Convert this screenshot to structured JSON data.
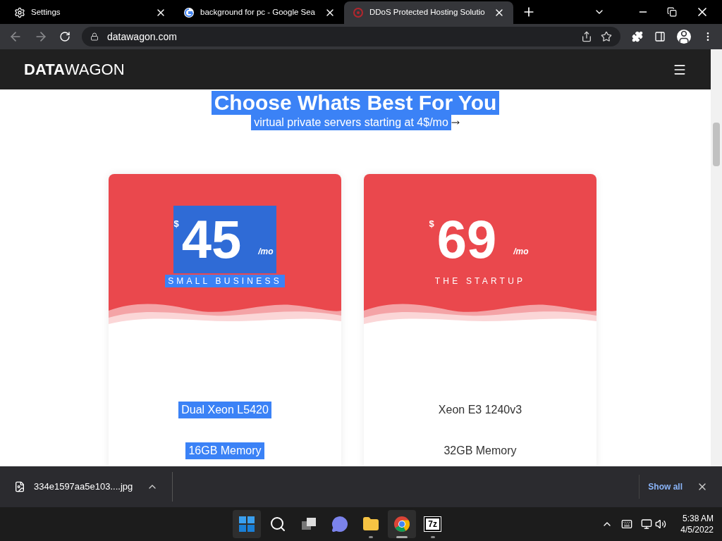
{
  "browser": {
    "tabs": [
      {
        "kind": "settings",
        "title": "Settings",
        "selected": false
      },
      {
        "kind": "google",
        "title": "background for pc - Google Sea",
        "selected": false
      },
      {
        "kind": "site",
        "title": "DDoS Protected Hosting Solutio",
        "selected": true
      }
    ],
    "url": "datawagon.com"
  },
  "site": {
    "logo_bold": "DATA",
    "logo_light": "WAGON",
    "heading": {
      "text": "Choose Whats Best For You",
      "highlighted": true
    },
    "subheading": {
      "text": "virtual private servers starting at 4$/mo",
      "highlighted": true
    },
    "cards": [
      {
        "currency": "$",
        "price": "45",
        "period": "/mo",
        "tier": "SMALL BUSINESS",
        "highlighted": true,
        "features": [
          {
            "text": "Dual Xeon L5420",
            "highlighted": true
          },
          {
            "text": "16GB Memory",
            "highlighted": true
          }
        ]
      },
      {
        "currency": "$",
        "price": "69",
        "period": "/mo",
        "tier": "THE STARTUP",
        "highlighted": false,
        "features": [
          {
            "text": "Xeon E3 1240v3",
            "highlighted": false
          },
          {
            "text": "32GB Memory",
            "highlighted": false
          }
        ]
      }
    ]
  },
  "downloads": {
    "file": "334e1597aa5e103....jpg",
    "show_all": "Show all"
  },
  "taskbar": {
    "apps": [
      {
        "kind": "start",
        "running": false,
        "active": true
      },
      {
        "kind": "search",
        "running": false,
        "active": false
      },
      {
        "kind": "taskview",
        "running": false,
        "active": false
      },
      {
        "kind": "chat",
        "running": false,
        "active": false
      },
      {
        "kind": "explorer",
        "running": true,
        "active": false
      },
      {
        "kind": "chrome",
        "running": true,
        "active": true
      },
      {
        "kind": "sevenzip",
        "label": "7z",
        "running": true,
        "active": false
      }
    ],
    "time": "5:38 AM",
    "date": "4/5/2022"
  }
}
